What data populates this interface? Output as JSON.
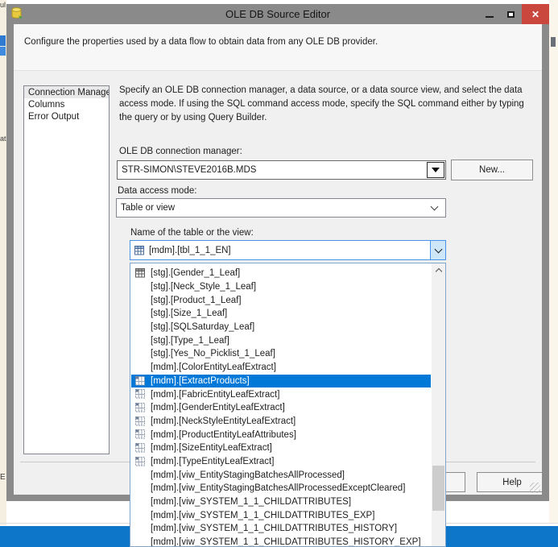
{
  "window": {
    "title": "OLE DB Source Editor",
    "icons": {
      "app": "database-icon",
      "minimize": "minimize-icon",
      "maximize": "maximize-icon",
      "close": "close-icon"
    }
  },
  "banner": {
    "text": "Configure the properties used by a data flow to obtain data from any OLE DB provider."
  },
  "sidebar": {
    "items": [
      {
        "label": "Connection Manager",
        "selected": true
      },
      {
        "label": "Columns",
        "selected": false
      },
      {
        "label": "Error Output",
        "selected": false
      }
    ]
  },
  "form": {
    "instructions": "Specify an OLE DB connection manager, a data source, or a data source view, and select the data access mode. If using the SQL command access mode, specify the SQL command either by typing the query or by using Query Builder.",
    "connection_manager": {
      "label": "OLE DB connection manager:",
      "value": "STR-SIMON\\STEVE2016B.MDS"
    },
    "new_button_label": "New...",
    "data_access_mode": {
      "label": "Data access mode:",
      "value": "Table or view"
    },
    "table_name": {
      "label": "Name of the table or the view:",
      "value": "[mdm].[tbl_1_1_EN]"
    }
  },
  "dropdown": {
    "items": [
      {
        "label": "[stg].[Gender_1_Leaf]",
        "icon": "table",
        "selected": false
      },
      {
        "label": "[stg].[Neck_Style_1_Leaf]",
        "icon": "none",
        "selected": false
      },
      {
        "label": "[stg].[Product_1_Leaf]",
        "icon": "none",
        "selected": false
      },
      {
        "label": "[stg].[Size_1_Leaf]",
        "icon": "none",
        "selected": false
      },
      {
        "label": "[stg].[SQLSaturday_Leaf]",
        "icon": "none",
        "selected": false
      },
      {
        "label": "[stg].[Type_1_Leaf]",
        "icon": "none",
        "selected": false
      },
      {
        "label": "[stg].[Yes_No_Picklist_1_Leaf]",
        "icon": "none",
        "selected": false
      },
      {
        "label": "[mdm].[ColorEntityLeafExtract]",
        "icon": "none",
        "selected": false
      },
      {
        "label": "[mdm].[ExtractProducts]",
        "icon": "view",
        "selected": true
      },
      {
        "label": "[mdm].[FabricEntityLeafExtract]",
        "icon": "view",
        "selected": false
      },
      {
        "label": "[mdm].[GenderEntityLeafExtract]",
        "icon": "view",
        "selected": false
      },
      {
        "label": "[mdm].[NeckStyleEntityLeafExtract]",
        "icon": "view",
        "selected": false
      },
      {
        "label": "[mdm].[ProductEntityLeafAttributes]",
        "icon": "view",
        "selected": false
      },
      {
        "label": "[mdm].[SizeEntityLeafExtract]",
        "icon": "view",
        "selected": false
      },
      {
        "label": "[mdm].[TypeEntityLeafExtract]",
        "icon": "view",
        "selected": false
      },
      {
        "label": "[mdm].[viw_EntityStagingBatchesAllProcessed]",
        "icon": "none",
        "selected": false
      },
      {
        "label": "[mdm].[viw_EntityStagingBatchesAllProcessedExceptCleared]",
        "icon": "none",
        "selected": false
      },
      {
        "label": "[mdm].[viw_SYSTEM_1_1_CHILDATTRIBUTES]",
        "icon": "none",
        "selected": false
      },
      {
        "label": "[mdm].[viw_SYSTEM_1_1_CHILDATTRIBUTES_EXP]",
        "icon": "none",
        "selected": false
      },
      {
        "label": "[mdm].[viw_SYSTEM_1_1_CHILDATTRIBUTES_HISTORY]",
        "icon": "none",
        "selected": false
      },
      {
        "label": "[mdm].[viw_SYSTEM_1_1_CHILDATTRIBUTES_HISTORY_EXP]",
        "icon": "none",
        "selected": false
      }
    ]
  },
  "footer": {
    "help_label": "Help"
  },
  "background_fragments": {
    "top": "ul",
    "mid": "at",
    "bottom": "E"
  },
  "colors": {
    "selection_blue": "#0078D7",
    "titlebar_gray": "#8A8A8A",
    "close_red": "#C9473D",
    "taskbar_blue": "#0D76C9",
    "focus_border_blue": "#4793E8"
  }
}
